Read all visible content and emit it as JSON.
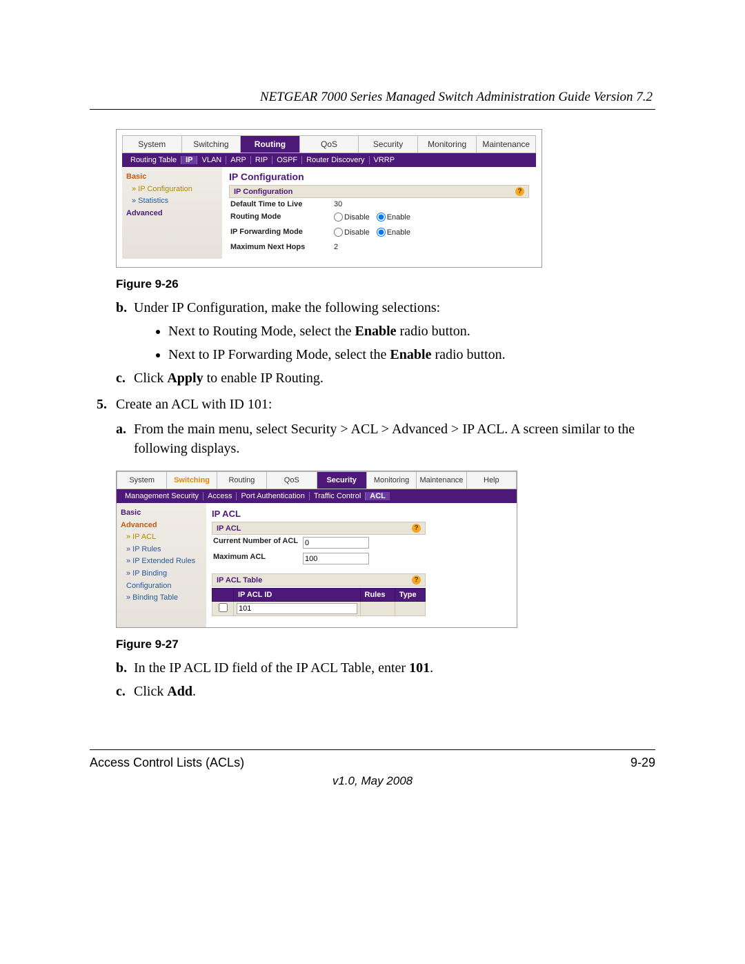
{
  "header_title": "NETGEAR 7000 Series Managed Switch Administration Guide Version 7.2",
  "figure1": {
    "caption": "Figure 9-26",
    "tabs": [
      "System",
      "Switching",
      "Routing",
      "QoS",
      "Security",
      "Monitoring",
      "Maintenance"
    ],
    "active_tab": "Routing",
    "subnav": [
      "Routing Table",
      "IP",
      "VLAN",
      "ARP",
      "RIP",
      "OSPF",
      "Router Discovery",
      "VRRP"
    ],
    "subnav_selected": "IP",
    "sidenav": {
      "basic": "Basic",
      "ip_config": "» IP Configuration",
      "statistics": "» Statistics",
      "advanced": "Advanced"
    },
    "content_title": "IP Configuration",
    "section_title": "IP Configuration",
    "rows": {
      "ttl_label": "Default Time to Live",
      "ttl_value": "30",
      "routing_label": "Routing Mode",
      "fwd_label": "IP Forwarding Mode",
      "hops_label": "Maximum Next Hops",
      "hops_value": "2",
      "disable": "Disable",
      "enable": "Enable"
    }
  },
  "instr1": {
    "b_text": "Under IP Configuration, make the following selections:",
    "bullet1_a": "Next to Routing Mode, select the ",
    "bullet1_b": "Enable",
    "bullet1_c": " radio button.",
    "bullet2_a": "Next to IP Forwarding Mode, select the ",
    "bullet2_b": "Enable",
    "bullet2_c": " radio button.",
    "c_text_a": "Click ",
    "c_text_b": "Apply",
    "c_text_c": " to enable IP Routing."
  },
  "step5": {
    "intro": "Create an ACL with ID 101:",
    "a_text": "From the main menu, select Security > ACL > Advanced > IP ACL. A screen similar to the following displays."
  },
  "figure2": {
    "caption": "Figure 9-27",
    "tabs": [
      "System",
      "Switching",
      "Routing",
      "QoS",
      "Security",
      "Monitoring",
      "Maintenance",
      "Help"
    ],
    "active_tab": "Security",
    "highlight_tab": "Switching",
    "subnav": [
      "Management Security",
      "Access",
      "Port Authentication",
      "Traffic Control",
      "ACL"
    ],
    "subnav_selected": "ACL",
    "sidenav": {
      "basic": "Basic",
      "advanced": "Advanced",
      "ip_acl": "» IP ACL",
      "ip_rules": "» IP Rules",
      "ip_ext": "» IP Extended Rules",
      "ip_bind": "» IP Binding Configuration",
      "bind_table": "» Binding Table"
    },
    "content_title": "IP ACL",
    "section1_title": "IP ACL",
    "curr_label": "Current Number of ACL",
    "curr_value": "0",
    "max_label": "Maximum ACL",
    "max_value": "100",
    "section2_title": "IP ACL Table",
    "th_id": "IP ACL ID",
    "th_rules": "Rules",
    "th_type": "Type",
    "row_id": "101"
  },
  "instr2": {
    "b_text_a": "In the IP ACL ID field of the IP ACL Table, enter ",
    "b_text_b": "101",
    "b_text_c": ".",
    "c_text_a": "Click ",
    "c_text_b": "Add",
    "c_text_c": "."
  },
  "footer": {
    "left": "Access Control Lists (ACLs)",
    "right": "9-29",
    "version": "v1.0, May 2008"
  }
}
